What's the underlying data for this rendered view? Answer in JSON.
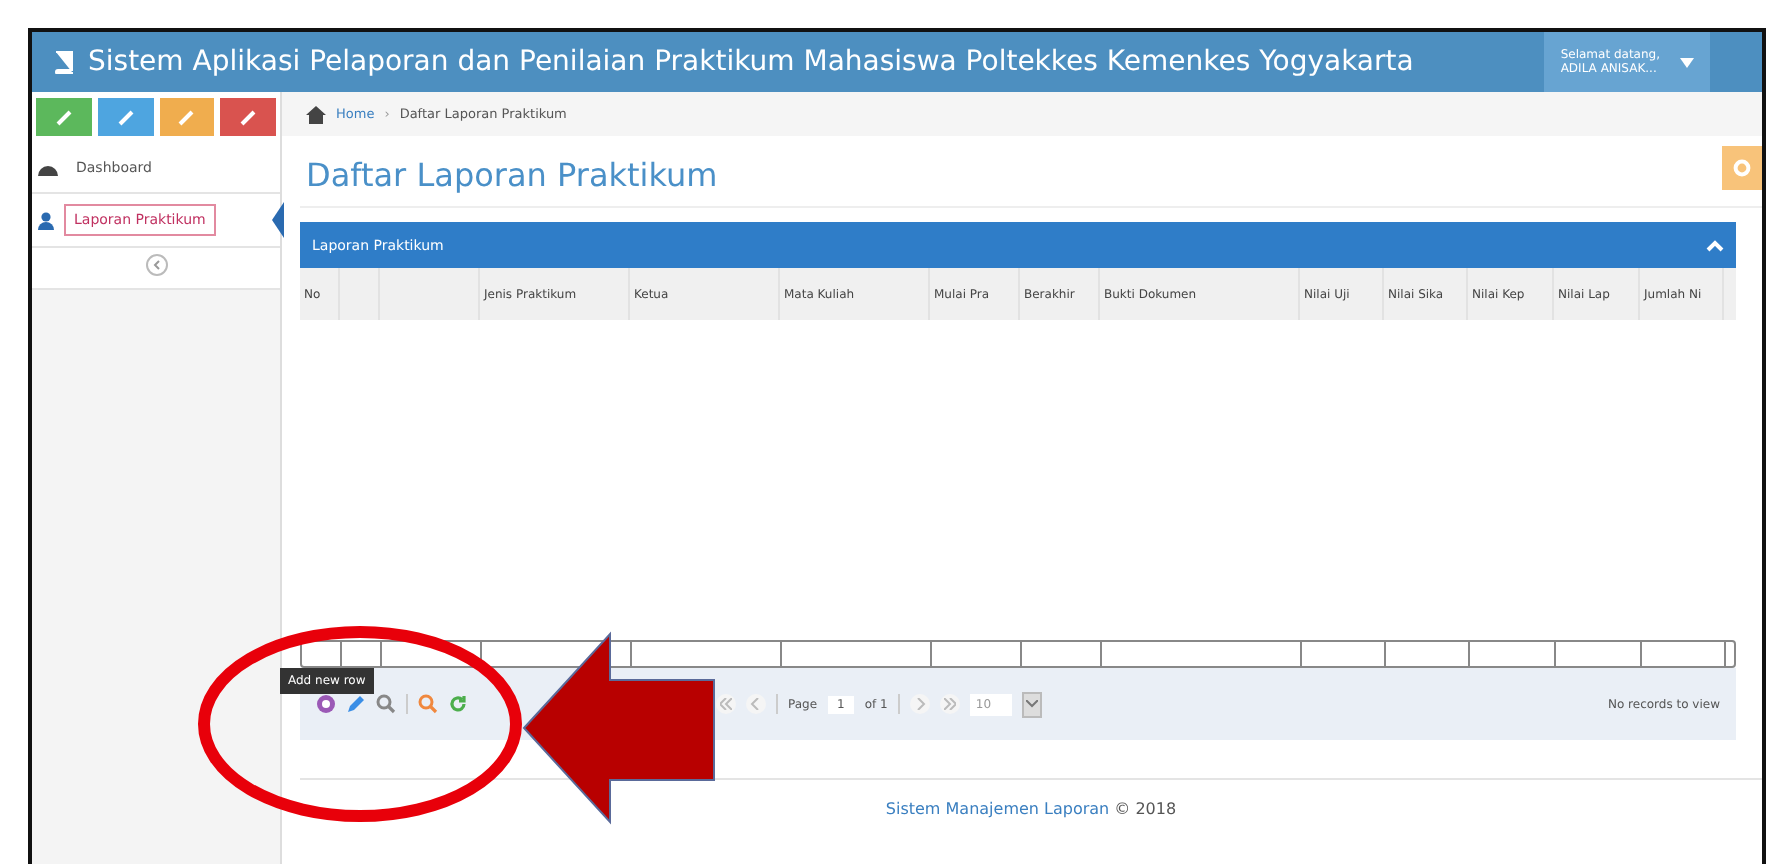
{
  "header": {
    "title": "Sistem Aplikasi Pelaporan dan Penilaian Praktikum Mahasiswa Poltekkes Kemenkes Yogyakarta",
    "greeting": "Selamat datang,",
    "user": "ADILA ANISAK..."
  },
  "shortcuts": [
    {
      "color": "#5cb85c"
    },
    {
      "color": "#4ea5e0"
    },
    {
      "color": "#f0ad4e"
    },
    {
      "color": "#d9534f"
    }
  ],
  "sidebar": {
    "items": [
      {
        "label": "Dashboard",
        "selected": false
      },
      {
        "label": "Laporan Praktikum",
        "selected": true
      }
    ]
  },
  "breadcrumb": [
    "Home",
    "›",
    "Daftar Laporan Praktikum"
  ],
  "page_title": "Daftar Laporan Praktikum",
  "panel": {
    "title": "Laporan Praktikum",
    "expanded": true
  },
  "table": {
    "columns": [
      "No",
      "",
      "",
      "Jenis Praktikum",
      "Ketua",
      "Mata Kuliah",
      "Mulai Pra",
      "Berakhir",
      "Bukti Dokumen",
      "Nilai Uji",
      "Nilai Sika",
      "Nilai Kep",
      "Nilai Lap",
      "Jumlah Ni"
    ]
  },
  "tooltip": "Add new row",
  "pager": {
    "page_label": "Page",
    "page": "1",
    "of": "of 1",
    "page_size": "10",
    "status": "No records to view"
  },
  "footer": {
    "link": "Sistem Manajemen Laporan",
    "text": "© 2018"
  }
}
